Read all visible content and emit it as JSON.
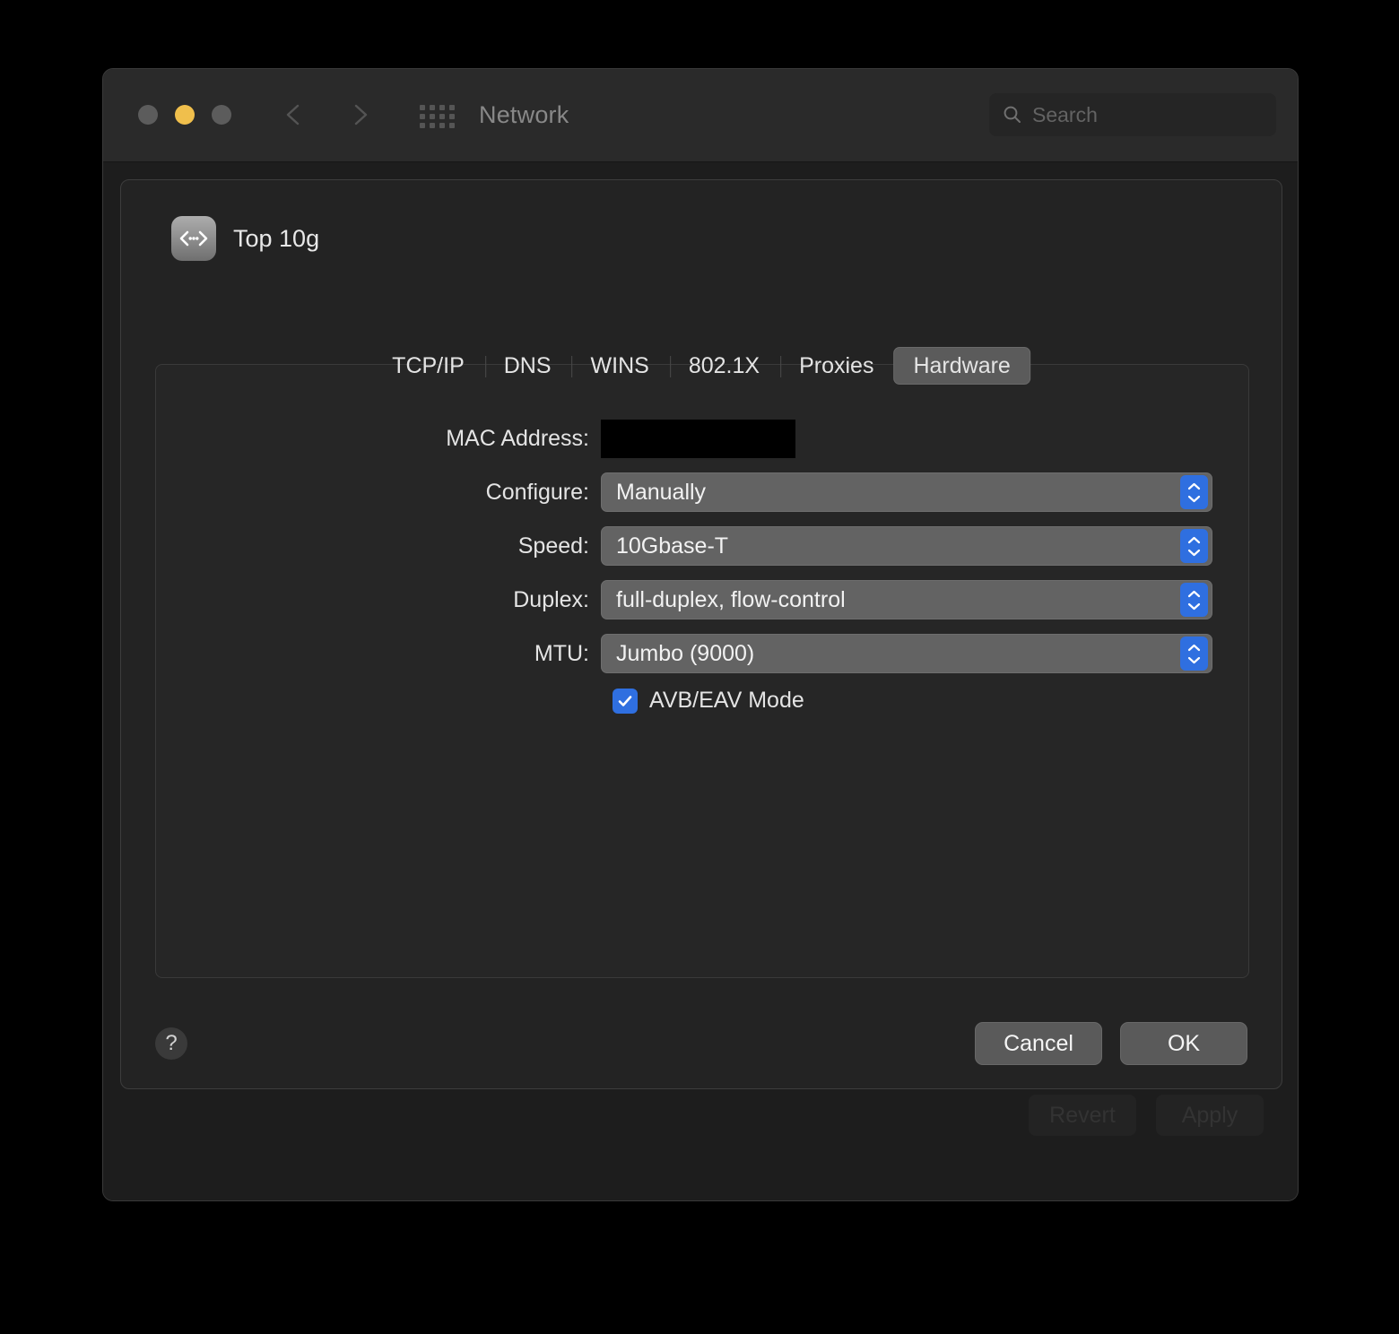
{
  "window": {
    "title": "Network",
    "traffic_lights": [
      {
        "name": "close",
        "color": "#5c5c5c"
      },
      {
        "name": "minimize",
        "color": "#f0bf4c"
      },
      {
        "name": "zoom",
        "color": "#5c5c5c"
      }
    ],
    "search": {
      "placeholder": "Search",
      "value": ""
    },
    "footer": {
      "revert_label": "Revert",
      "apply_label": "Apply"
    }
  },
  "sheet": {
    "service": {
      "name": "Top 10g",
      "icon": "ethernet-icon"
    },
    "tabs": [
      {
        "label": "TCP/IP",
        "selected": false
      },
      {
        "label": "DNS",
        "selected": false
      },
      {
        "label": "WINS",
        "selected": false
      },
      {
        "label": "802.1X",
        "selected": false
      },
      {
        "label": "Proxies",
        "selected": false
      },
      {
        "label": "Hardware",
        "selected": true
      }
    ],
    "fields": {
      "mac_address_label": "MAC Address:",
      "mac_address_value": "",
      "configure_label": "Configure:",
      "configure_value": "Manually",
      "speed_label": "Speed:",
      "speed_value": "10Gbase-T",
      "duplex_label": "Duplex:",
      "duplex_value": "full-duplex, flow-control",
      "mtu_label": "MTU:",
      "mtu_value": "Jumbo  (9000)",
      "avb_label": "AVB/EAV Mode",
      "avb_checked": true
    },
    "footer": {
      "help_label": "?",
      "cancel_label": "Cancel",
      "ok_label": "OK"
    }
  },
  "colors": {
    "accent_blue": "#2f6fe0",
    "window_bg": "#1d1d1d",
    "sheet_bg": "#232323",
    "popup_bg": "#636363",
    "minimize_yellow": "#f0bf4c"
  }
}
